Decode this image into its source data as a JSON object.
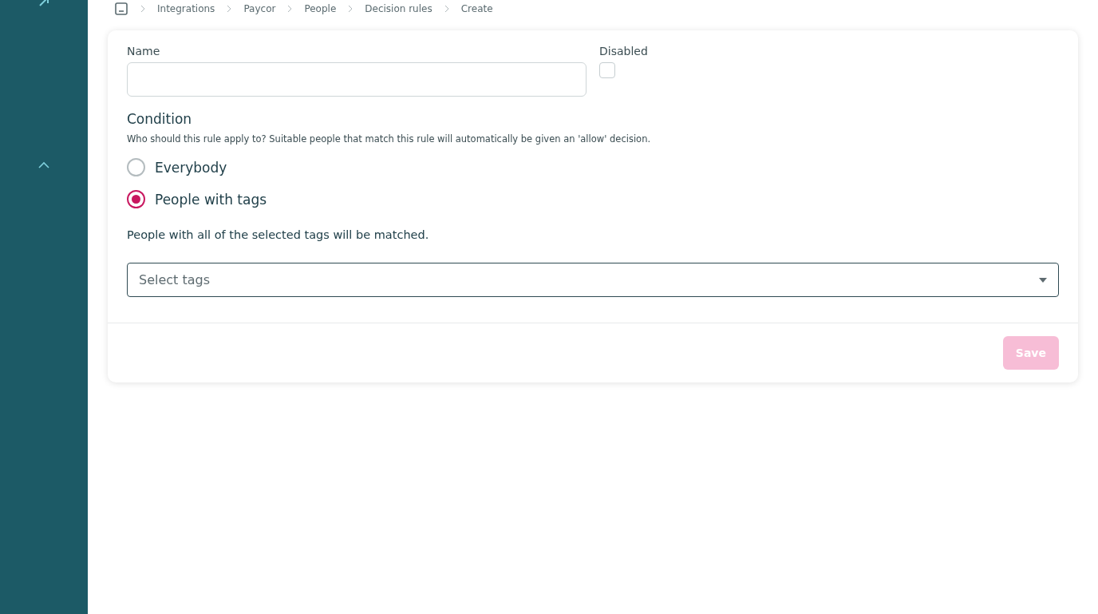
{
  "breadcrumb": [
    "Integrations",
    "Paycor",
    "People",
    "Decision rules",
    "Create"
  ],
  "form": {
    "name_label": "Name",
    "disabled_label": "Disabled",
    "disabled_checked": false,
    "condition_title": "Condition",
    "condition_help": "Who should this rule apply to? Suitable people that match this rule will automatically be given an 'allow' decision.",
    "options": [
      {
        "label": "Everybody",
        "selected": false
      },
      {
        "label": "People with tags",
        "selected": true
      }
    ],
    "tags_help": "People with all of the selected tags will be matched.",
    "tags_placeholder": "Select tags"
  },
  "save_button": {
    "label": "Save",
    "disabled": true
  }
}
